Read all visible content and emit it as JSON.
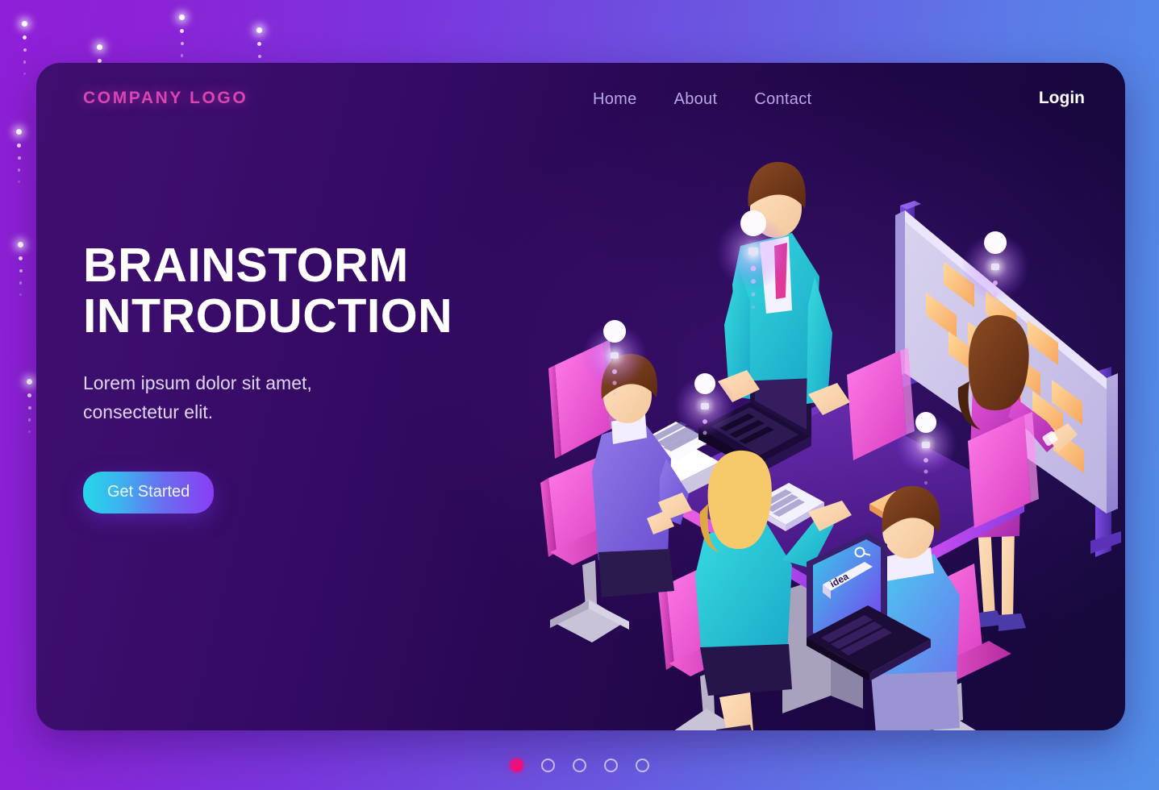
{
  "theme": {
    "accent_pink": "#d946b4",
    "accent_magenta": "#ec0f7e",
    "cta_gradient_from": "#25d7e8",
    "cta_gradient_to": "#8b3df2",
    "card_bg_left": "#3f0f70",
    "card_bg_right": "#160a3d",
    "page_bg_left": "#8f1fd8",
    "page_bg_right": "#5290ea",
    "nav_link_color": "#b9a8e6"
  },
  "header": {
    "logo": "COMPANY LOGO",
    "nav": [
      {
        "label": "Home"
      },
      {
        "label": "About"
      },
      {
        "label": "Contact"
      }
    ],
    "login_label": "Login"
  },
  "hero": {
    "title_line1": "BRAINSTORM",
    "title_line2": "INTRODUCTION",
    "subtitle_line1": "Lorem ipsum dolor sit amet,",
    "subtitle_line2": "consectetur elit.",
    "cta_label": "Get Started"
  },
  "illustration": {
    "name": "isometric-brainstorm-meeting",
    "laptop_screen_text": "idea",
    "laptop_screen_icon": "search-icon",
    "whiteboard_sticky_note_count": 11,
    "lightbulb_count": 4,
    "people_count": 5,
    "chair_count": 6
  },
  "pagination": {
    "total": 5,
    "active_index": 0,
    "dots": [
      {
        "active": true
      },
      {
        "active": false
      },
      {
        "active": false
      },
      {
        "active": false
      },
      {
        "active": false
      }
    ]
  }
}
